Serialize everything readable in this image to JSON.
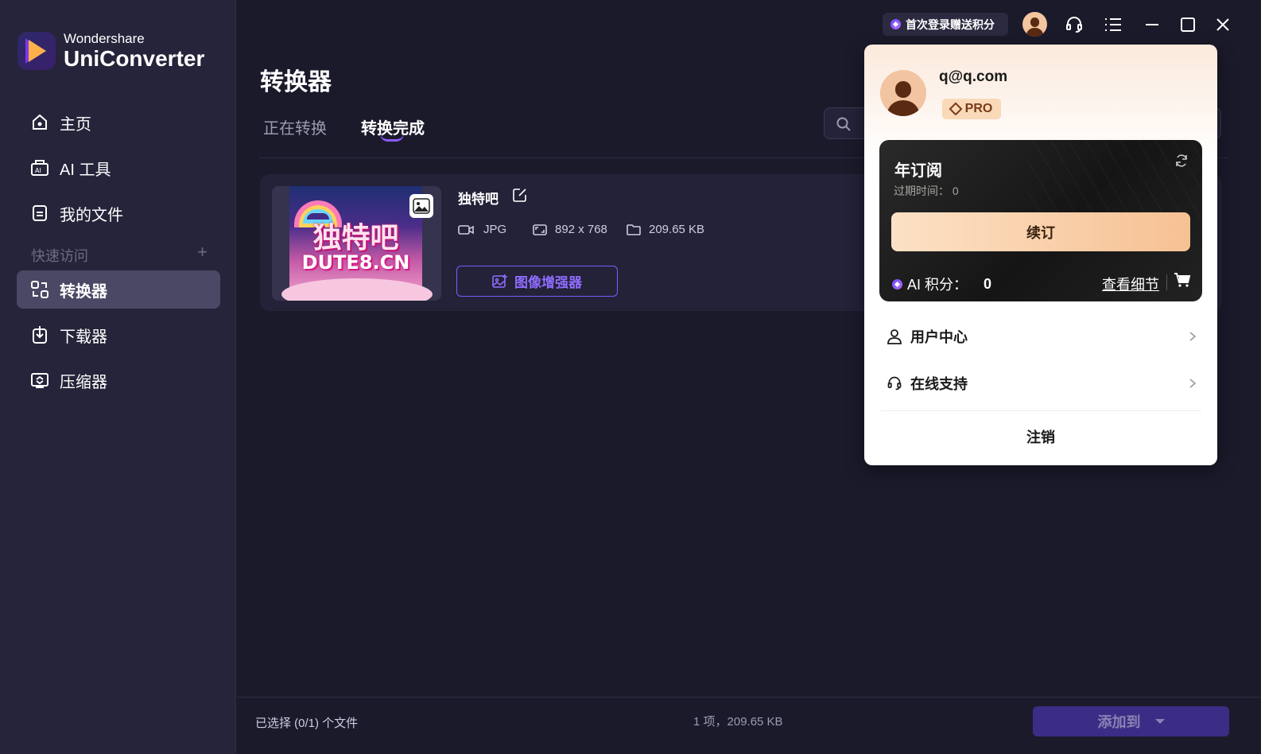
{
  "app": {
    "brand": "Wondershare",
    "product": "UniConverter"
  },
  "sidebar": {
    "items": [
      {
        "label": "主页",
        "icon": "home-icon"
      },
      {
        "label": "AI 工具",
        "icon": "ai-tools-icon"
      },
      {
        "label": "我的文件",
        "icon": "files-icon"
      },
      {
        "label": "转换器",
        "icon": "converter-icon",
        "active": true
      },
      {
        "label": "下载器",
        "icon": "downloader-icon"
      },
      {
        "label": "压缩器",
        "icon": "compressor-icon"
      }
    ],
    "quick_access": "快速访问",
    "quick_access_add": "+"
  },
  "main": {
    "title": "转换器",
    "tabs": [
      {
        "label": "正在转换"
      },
      {
        "label": "转换完成",
        "active": true
      }
    ],
    "file": {
      "name": "独特吧",
      "format": "JPG",
      "resolution": "892 x 768",
      "size": "209.65 KB",
      "thumb_text_1": "独特吧",
      "thumb_text_2": "DUTE8.CN",
      "enhance_label": "图像增强器"
    }
  },
  "footer": {
    "selected": "已选择 (0/1) 个文件",
    "summary": "1 项，209.65 KB",
    "add_to": "添加到"
  },
  "titlebar": {
    "promo": "首次登录赠送积分"
  },
  "popup": {
    "email": "q@q.com",
    "badge": "PRO",
    "plan": "年订阅",
    "expire": "过期时间： 0",
    "renew": "续订",
    "ai_points_label": "AI 积分：",
    "ai_points_value": "0",
    "details": "查看细节",
    "menu": [
      {
        "label": "用户中心"
      },
      {
        "label": "在线支持"
      }
    ],
    "logout": "注销"
  },
  "colors": {
    "accent": "#7a5cff",
    "sidebar_bg": "#25243a",
    "main_bg": "#1b1a2b",
    "renew_gold": "#f6c193"
  }
}
